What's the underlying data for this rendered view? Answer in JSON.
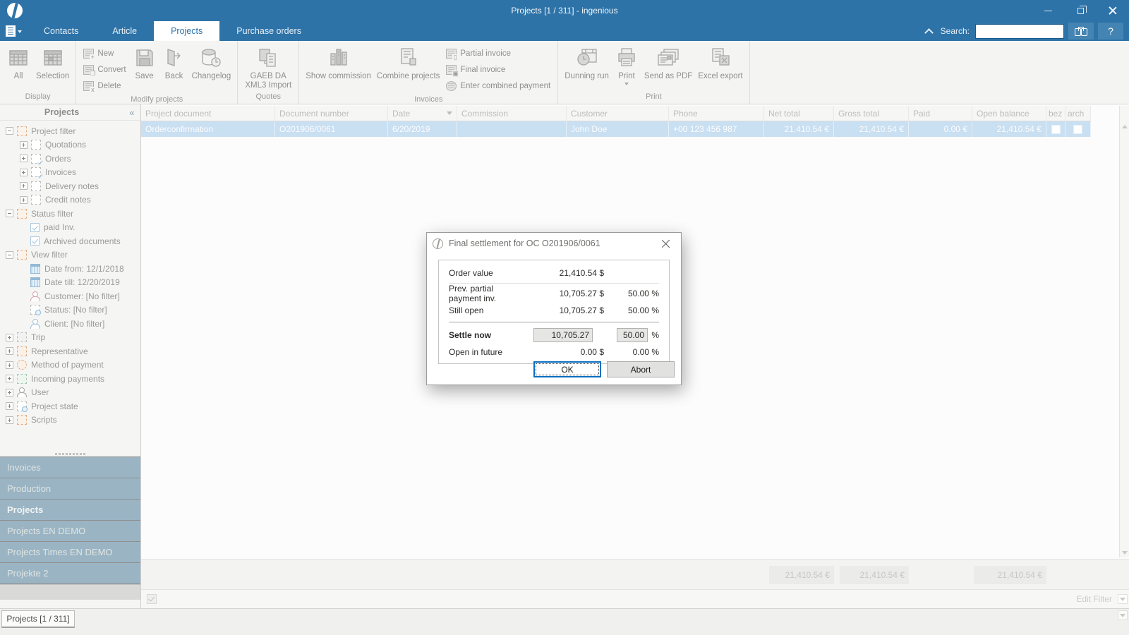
{
  "window": {
    "title": "Projects [1 / 311] - ingenious"
  },
  "tabs": {
    "contacts": "Contacts",
    "article": "Article",
    "projects": "Projects",
    "purchase_orders": "Purchase orders"
  },
  "search": {
    "label": "Search:",
    "value": "",
    "help_label": "?"
  },
  "ribbon": {
    "all": "All",
    "selection": "Selection",
    "display_group": "Display",
    "new": "New",
    "convert": "Convert",
    "delete": "Delete",
    "save": "Save",
    "back": "Back",
    "changelog": "Changelog",
    "modify_group": "Modify projects",
    "gaeb": "GAEB DA XML3 Import",
    "quotes_group": "Quotes",
    "show_commission": "Show commission",
    "combine_projects": "Combine projects",
    "partial_invoice": "Partial invoice",
    "final_invoice": "Final invoice",
    "enter_combined_payment": "Enter combined payment",
    "invoices_group": "Invoices",
    "dunning_run": "Dunning run",
    "print": "Print",
    "send_as_pdf": "Send as PDF",
    "excel_export": "Excel export",
    "print_group": "Print"
  },
  "sidebar": {
    "title": "Projects",
    "tree": [
      {
        "label": "Project filter"
      },
      {
        "label": "Quotations"
      },
      {
        "label": "Orders"
      },
      {
        "label": "Invoices"
      },
      {
        "label": "Delivery notes"
      },
      {
        "label": "Credit notes"
      },
      {
        "label": "Status filter"
      },
      {
        "label": "paid Inv."
      },
      {
        "label": "Archived documents"
      },
      {
        "label": "View filter"
      },
      {
        "label": "Date from: 12/1/2018"
      },
      {
        "label": "Date till: 12/20/2019"
      },
      {
        "label": "Customer: [No filter]"
      },
      {
        "label": "Status: [No filter]"
      },
      {
        "label": "Client: [No filter]"
      },
      {
        "label": "Trip"
      },
      {
        "label": "Representative"
      },
      {
        "label": "Method of payment"
      },
      {
        "label": "Incoming payments"
      },
      {
        "label": "User"
      },
      {
        "label": "Project state"
      },
      {
        "label": "Scripts"
      }
    ],
    "panels": [
      {
        "label": "Invoices"
      },
      {
        "label": "Production"
      },
      {
        "label": "Projects"
      },
      {
        "label": "Projects EN DEMO"
      },
      {
        "label": "Projects Times EN DEMO"
      },
      {
        "label": "Projekte 2"
      }
    ]
  },
  "grid": {
    "columns": [
      "Project document",
      "Document number",
      "Date",
      "Commission",
      "Customer",
      "Phone",
      "Net total",
      "Gross total",
      "Paid",
      "Open balance",
      "bez",
      "arch"
    ],
    "row": [
      "Orderconfirmation",
      "O201906/0061",
      "6/20/2019",
      "",
      "John Doe",
      "+00 123 456 987",
      "21,410.54 €",
      "21,410.54 €",
      "0.00 €",
      "21,410.54 €"
    ],
    "footer": {
      "net_total": "21,410.54 €",
      "gross_total": "21,410.54 €",
      "open_balance": "21,410.54 €"
    },
    "edit_filter": "Edit Filter"
  },
  "dialog": {
    "title": "Final settlement for OC O201906/0061",
    "order_value_label": "Order value",
    "order_value": "21,410.54 $",
    "prev_label": "Prev. partial payment inv.",
    "prev_value": "10,705.27 $",
    "prev_pct": "50.00 %",
    "still_label": "Still open",
    "still_value": "10,705.27 $",
    "still_pct": "50.00 %",
    "settle_label": "Settle now",
    "settle_value": "10,705.27",
    "settle_pct": "50.00",
    "percent_sign": "%",
    "future_label": "Open in future",
    "future_value": "0.00 $",
    "future_pct": "0.00 %",
    "ok": "OK",
    "abort": "Abort"
  },
  "statusbar": {
    "tab": "Projects [1 / 311]"
  }
}
